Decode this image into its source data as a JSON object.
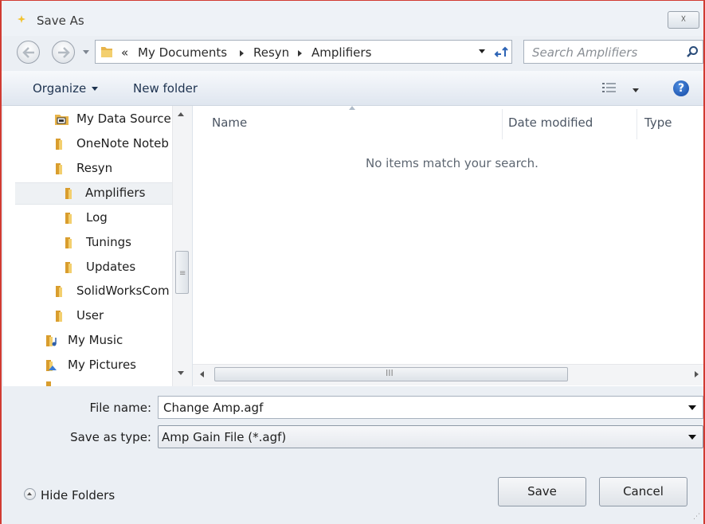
{
  "window": {
    "title": "Save As",
    "close_label": "☓"
  },
  "address_bar": {
    "overflow": "«",
    "crumbs": [
      "My Documents",
      "Resyn",
      "Amplifiers"
    ]
  },
  "search": {
    "placeholder": "Search Amplifiers"
  },
  "toolbar": {
    "organize_label": "Organize",
    "new_folder_label": "New folder",
    "help_label": "?"
  },
  "nav_tree": {
    "items": [
      {
        "label": "My Data Source",
        "icon": "data-source-folder-icon"
      },
      {
        "label": "OneNote Noteb",
        "icon": "folder-icon"
      },
      {
        "label": "Resyn",
        "icon": "folder-icon"
      },
      {
        "label": "Amplifiers",
        "icon": "folder-icon",
        "selected": true
      },
      {
        "label": "Log",
        "icon": "folder-icon"
      },
      {
        "label": "Tunings",
        "icon": "folder-icon"
      },
      {
        "label": "Updates",
        "icon": "folder-icon"
      },
      {
        "label": "SolidWorksCom",
        "icon": "folder-icon"
      },
      {
        "label": "User",
        "icon": "folder-icon"
      },
      {
        "label": "My Music",
        "icon": "music-folder-icon"
      },
      {
        "label": "My Pictures",
        "icon": "pictures-folder-icon"
      }
    ]
  },
  "file_list": {
    "columns": [
      "Name",
      "Date modified",
      "Type"
    ],
    "empty_message": "No items match your search."
  },
  "form": {
    "file_name_label": "File name:",
    "file_name_value": "Change Amp.agf",
    "save_as_type_label": "Save as type:",
    "save_as_type_value": "Amp Gain File (*.agf)"
  },
  "footer": {
    "hide_folders_label": "Hide Folders",
    "save_label": "Save",
    "cancel_label": "Cancel"
  },
  "colors": {
    "frame_accent": "#d13b32",
    "folder": "#e8b44a",
    "help": "#1f5fbf"
  }
}
